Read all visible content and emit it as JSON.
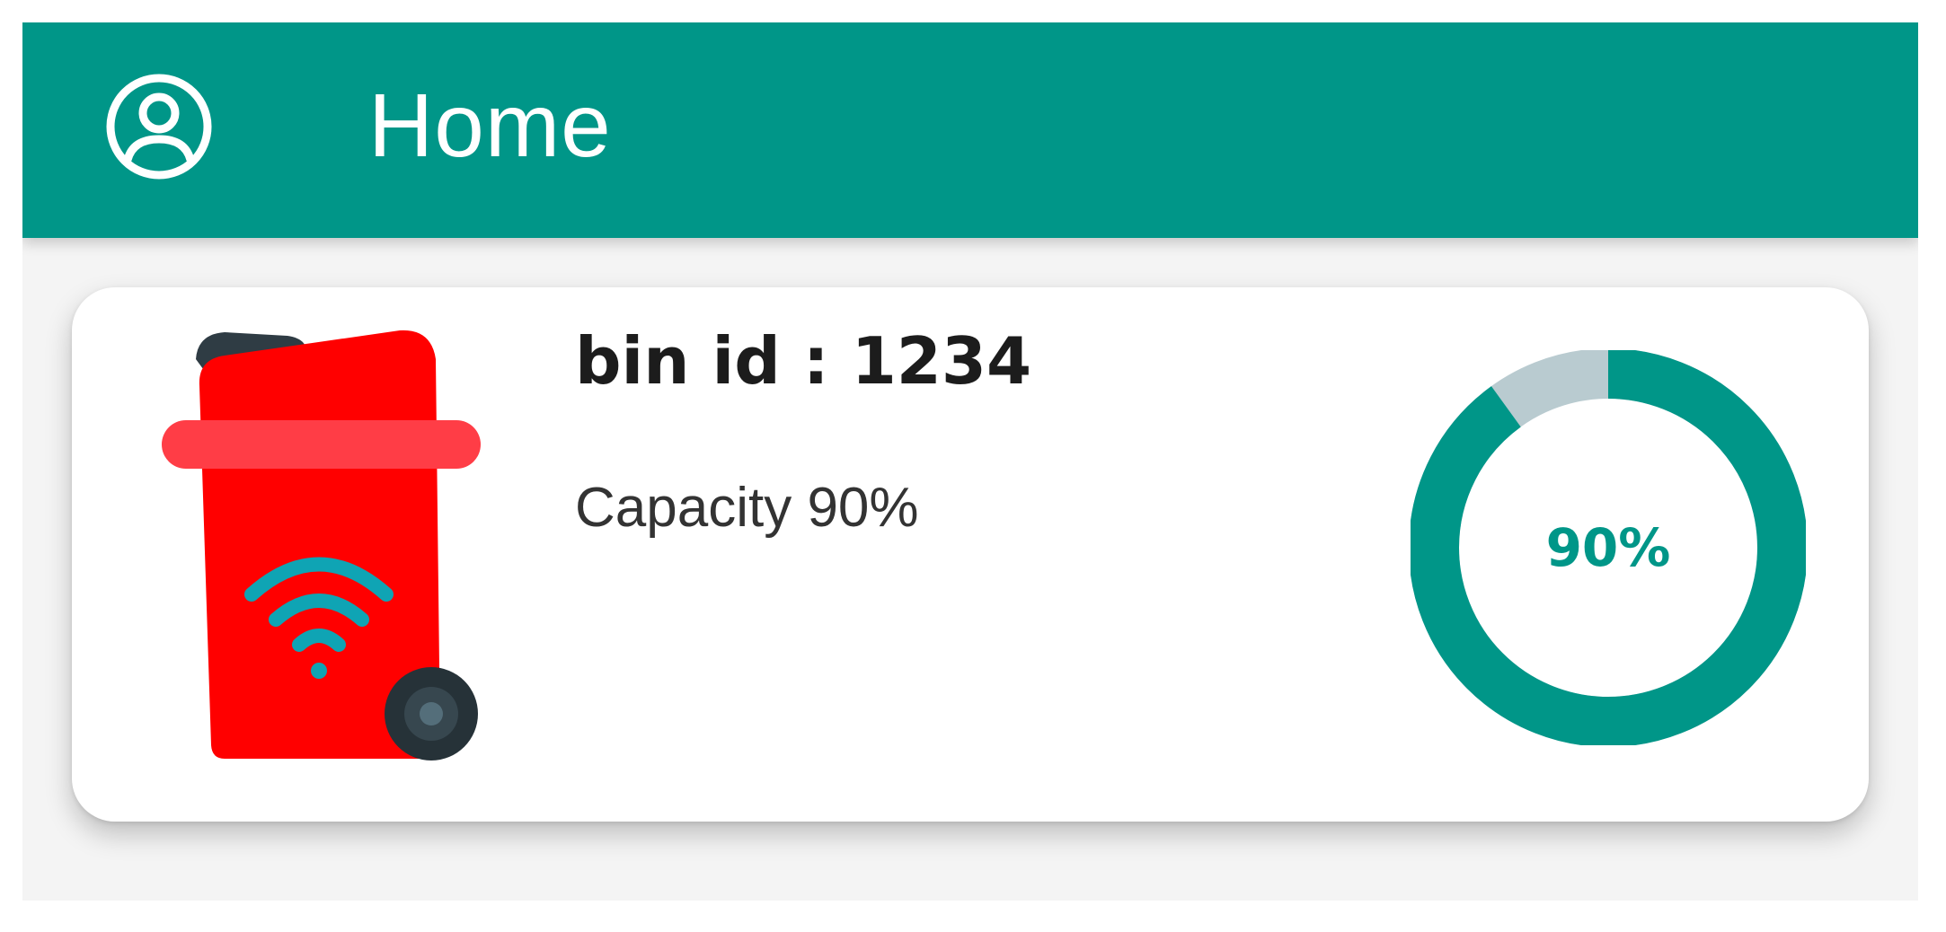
{
  "theme": {
    "primary": "#009688",
    "track": "#b9cbd0",
    "bin_body": "#ff0000",
    "bin_rim": "#ff3d46",
    "bin_lid": "#2f3c44",
    "wifi": "#0fa4b4"
  },
  "appbar": {
    "title": "Home",
    "profile_icon": "account-circle-icon"
  },
  "bin_card": {
    "bin_id_label": "bin id : 1234",
    "capacity_label": "Capacity 90%",
    "fill_level": 0.9,
    "gauge_label": "90%",
    "icon": "smart-bin-icon"
  }
}
